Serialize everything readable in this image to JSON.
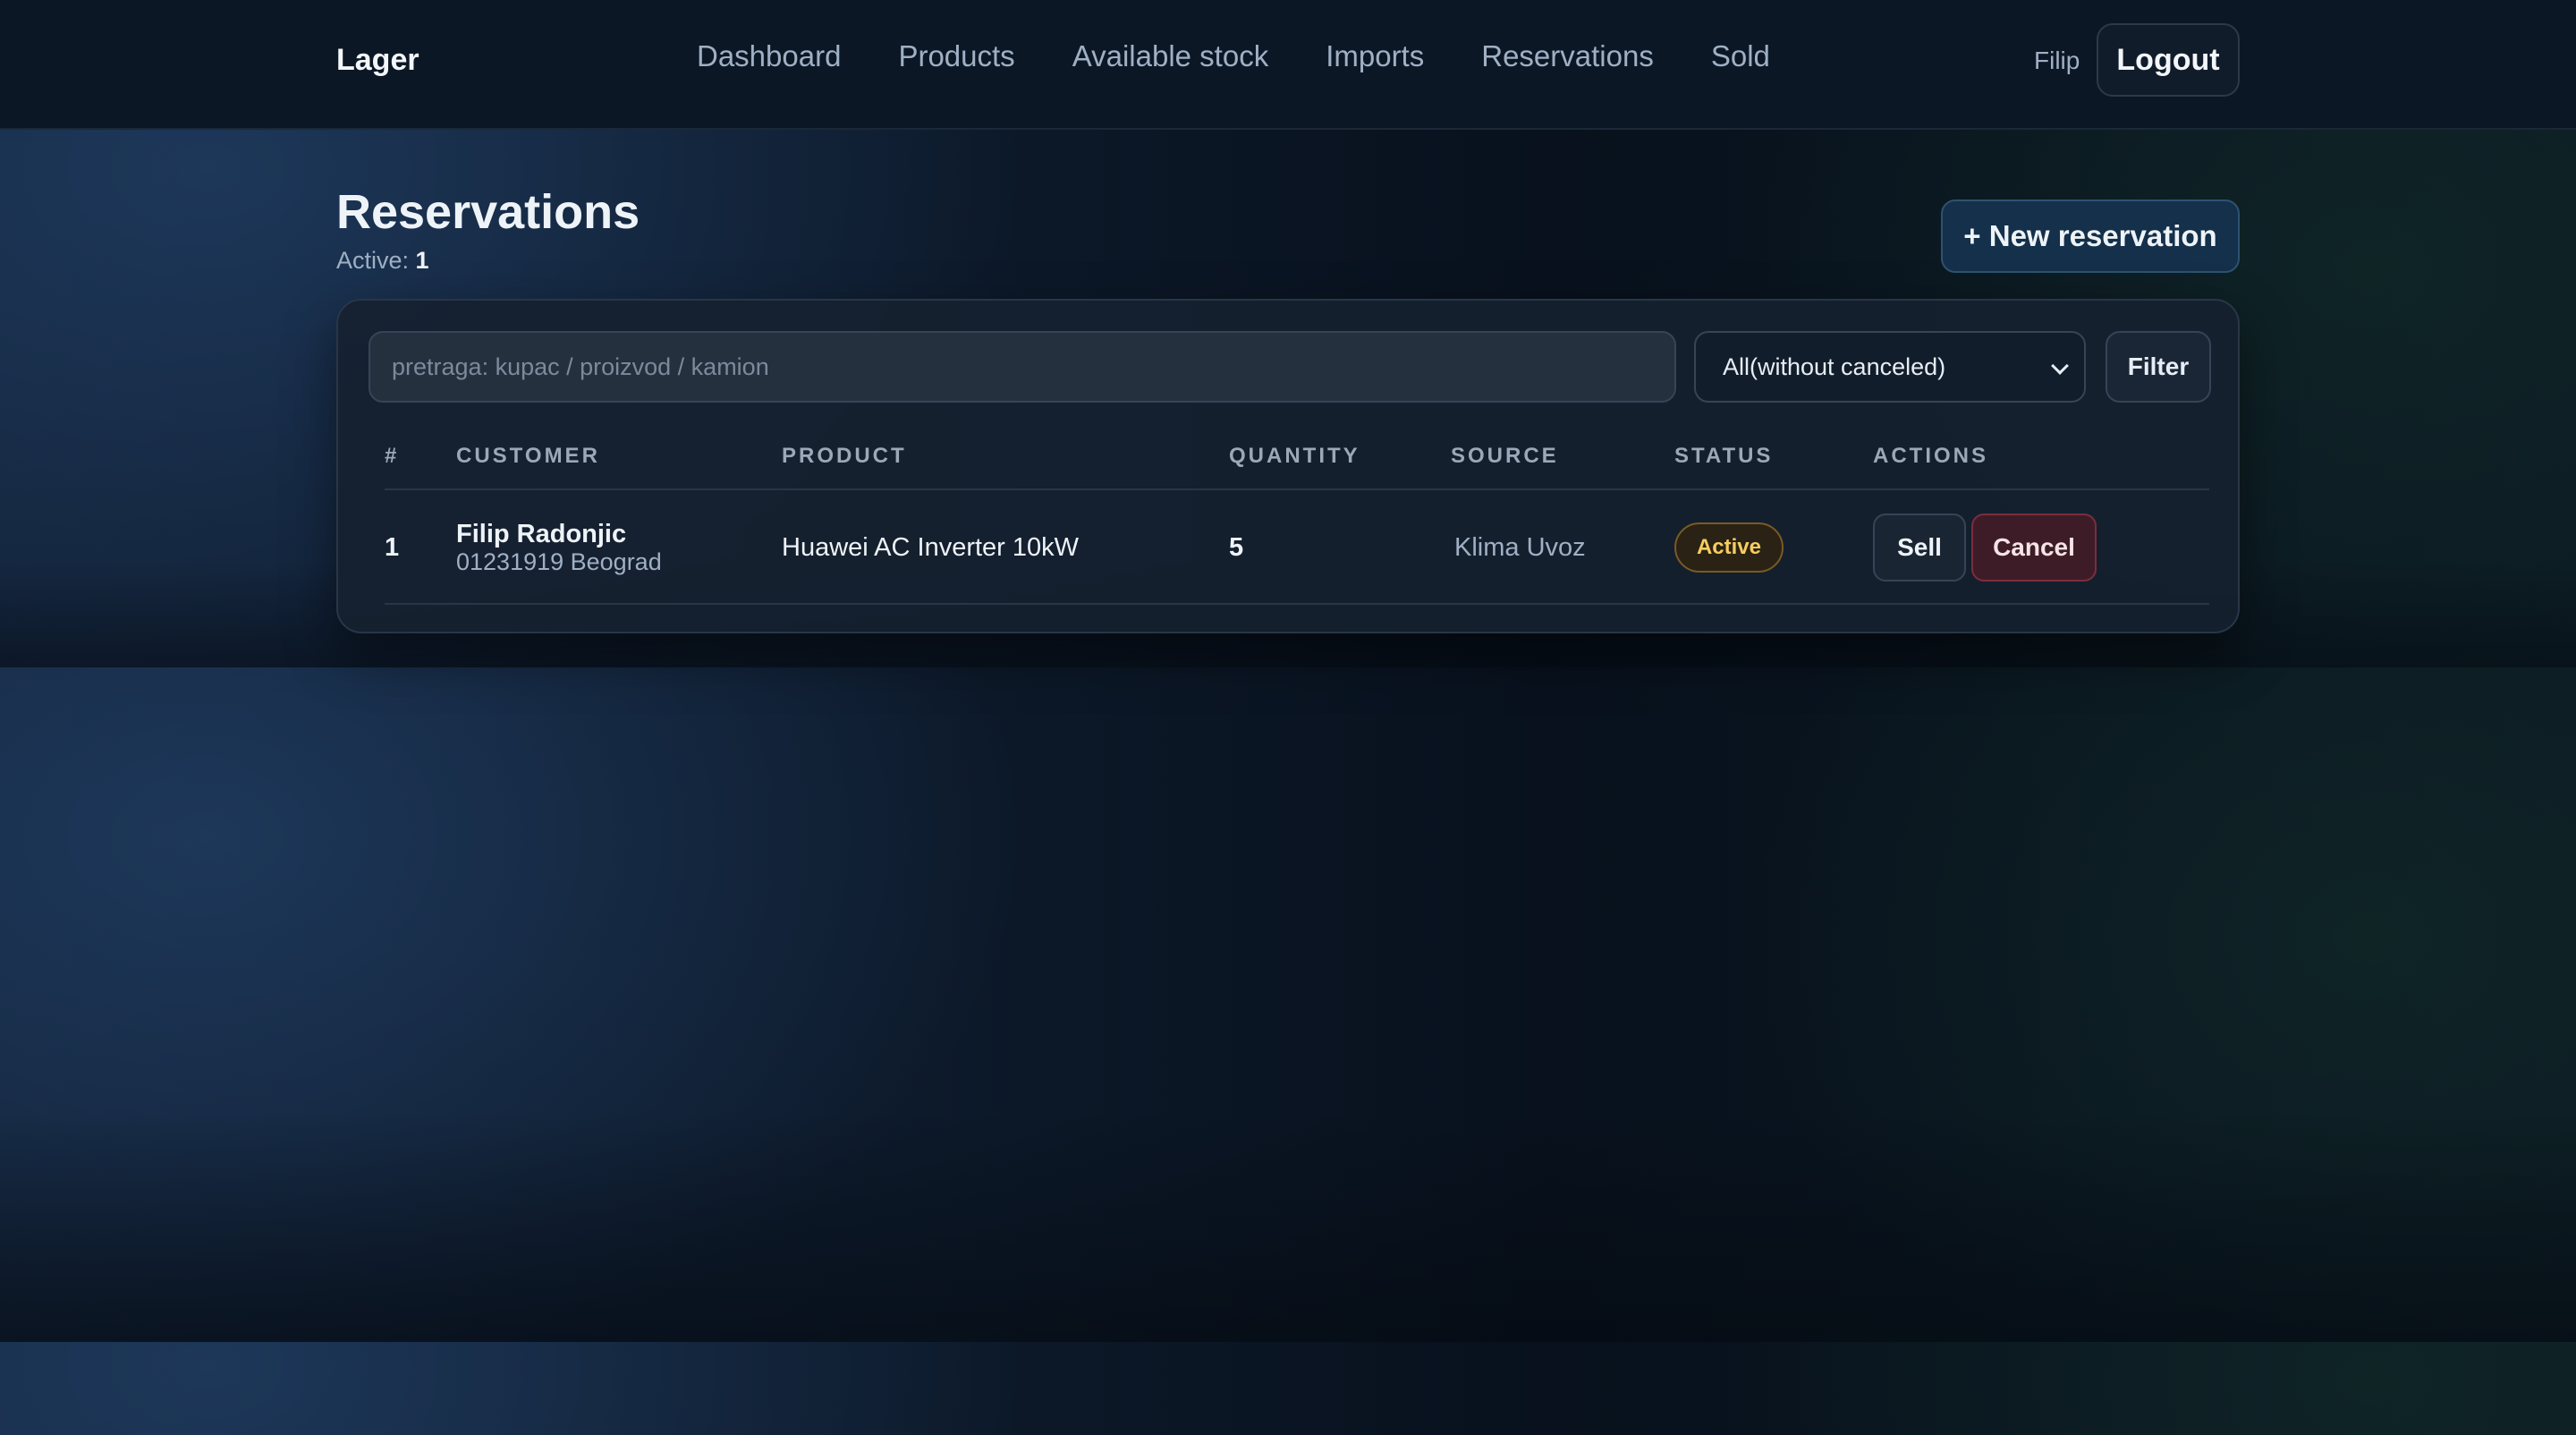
{
  "app": {
    "brand": "Lager"
  },
  "nav": {
    "items": [
      {
        "label": "Dashboard"
      },
      {
        "label": "Products"
      },
      {
        "label": "Available stock"
      },
      {
        "label": "Imports"
      },
      {
        "label": "Reservations"
      },
      {
        "label": "Sold"
      }
    ],
    "user": "Filip",
    "logout_label": "Logout"
  },
  "page": {
    "title": "Reservations",
    "active_label": "Active:",
    "active_count": "1",
    "new_button": "+ New reservation"
  },
  "filters": {
    "search_placeholder": "pretraga: kupac / proizvod / kamion",
    "search_value": "",
    "status_selected": "All(without canceled)",
    "filter_button": "Filter"
  },
  "table": {
    "headers": [
      "#",
      "CUSTOMER",
      "PRODUCT",
      "QUANTITY",
      "SOURCE",
      "STATUS",
      "ACTIONS"
    ],
    "rows": [
      {
        "num": "1",
        "customer_name": "Filip Radonjic",
        "customer_detail": "01231919 Beograd",
        "product": "Huawei AC Inverter 10kW",
        "quantity": "5",
        "source": "Klima Uvoz",
        "status": "Active",
        "sell_label": "Sell",
        "cancel_label": "Cancel"
      }
    ]
  },
  "colors": {
    "status_active": "#f7cd60",
    "primary_button": "#14304a",
    "danger_button": "#3d1c28"
  }
}
